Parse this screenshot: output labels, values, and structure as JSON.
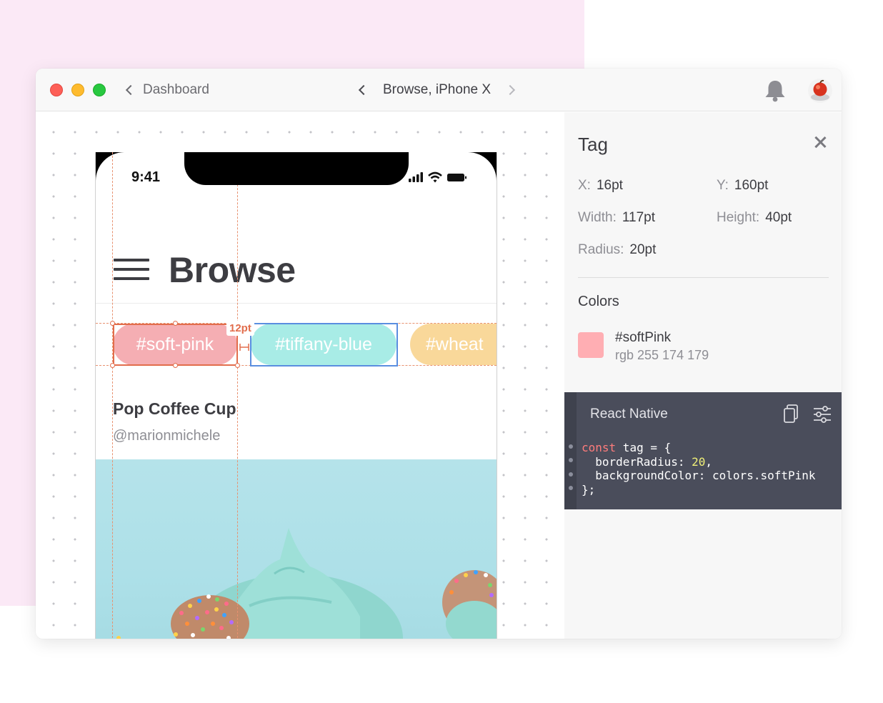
{
  "titlebar": {
    "back_label": "Dashboard",
    "screen_title": "Browse, iPhone X"
  },
  "phone": {
    "time": "9:41",
    "title": "Browse",
    "tags": [
      {
        "label": "#soft-pink",
        "color": "#f5aeb3"
      },
      {
        "label": "#tiffany-blue",
        "color": "#a8ece6"
      },
      {
        "label": "#wheat",
        "color": "#f9d89a"
      }
    ],
    "spacing_badge": "12pt",
    "card": {
      "title": "Pop Coffee Cup",
      "author": "@marionmichele"
    }
  },
  "inspector": {
    "title": "Tag",
    "props": {
      "x_label": "X:",
      "x_value": "16pt",
      "y_label": "Y:",
      "y_value": "160pt",
      "width_label": "Width:",
      "width_value": "117pt",
      "height_label": "Height:",
      "height_value": "40pt",
      "radius_label": "Radius:",
      "radius_value": "20pt"
    },
    "colors_heading": "Colors",
    "color": {
      "name": "#softPink",
      "rgb": "rgb 255 174 179",
      "hex": "#ffaeb3"
    },
    "code": {
      "language": "React Native",
      "kw": "const",
      "line1_rest": " tag = {",
      "line2_key": "  borderRadius: ",
      "line2_num": "20",
      "line2_end": ",",
      "line3": "  backgroundColor: colors.softPink",
      "line4": "};"
    }
  }
}
